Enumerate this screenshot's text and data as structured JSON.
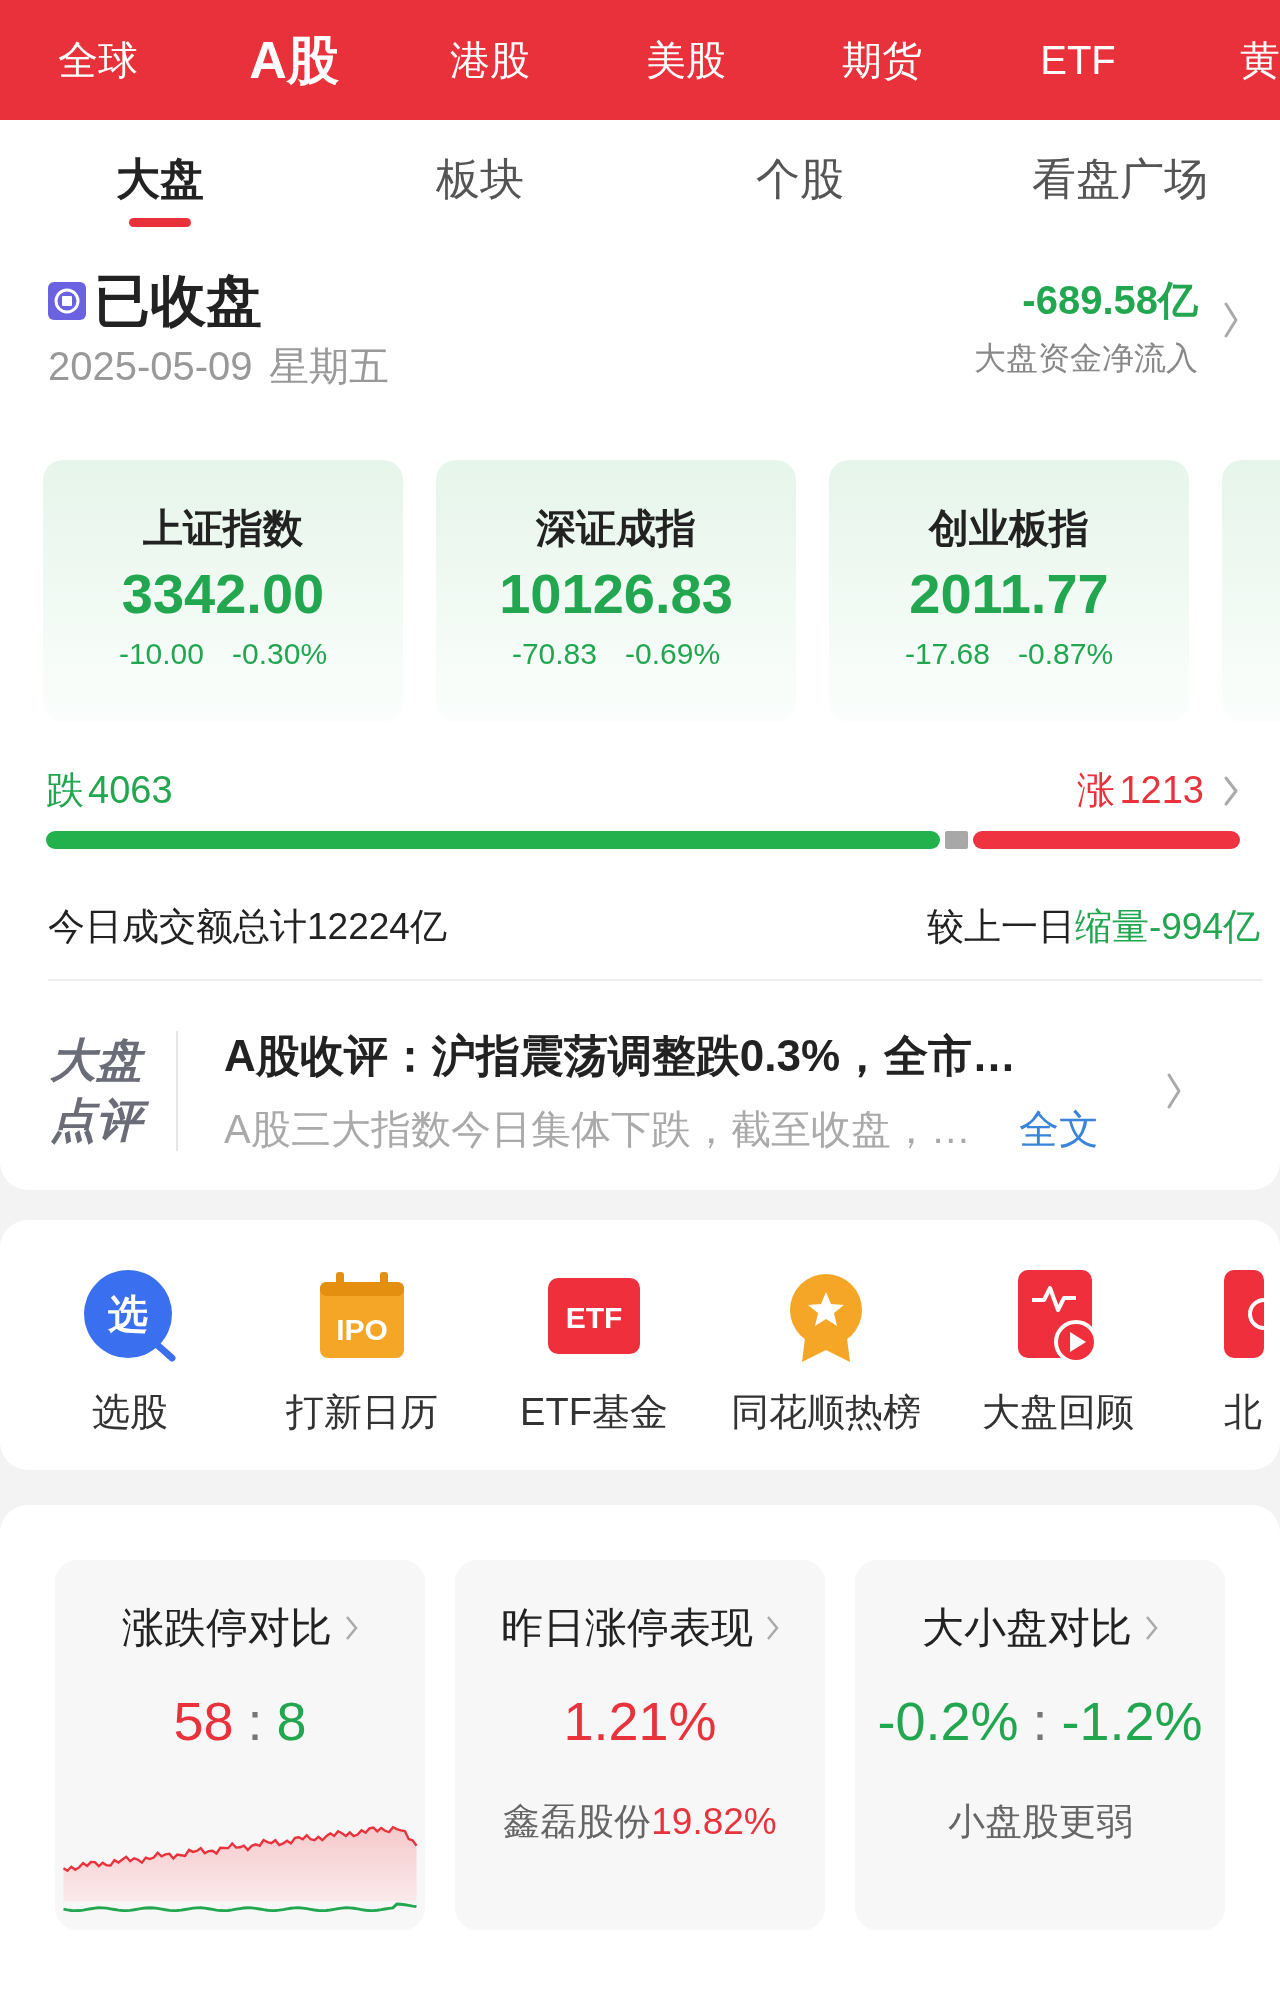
{
  "market_tabs": [
    {
      "label": "全球",
      "selected": false
    },
    {
      "label": "A股",
      "selected": true
    },
    {
      "label": "港股",
      "selected": false
    },
    {
      "label": "美股",
      "selected": false
    },
    {
      "label": "期货",
      "selected": false
    },
    {
      "label": "ETF",
      "selected": false
    },
    {
      "label": "黄",
      "selected": false
    }
  ],
  "sub_tabs": [
    {
      "label": "大盘",
      "selected": true
    },
    {
      "label": "板块",
      "selected": false
    },
    {
      "label": "个股",
      "selected": false
    },
    {
      "label": "看盘广场",
      "selected": false
    }
  ],
  "status": {
    "label": "已收盘",
    "date": "2025-05-09",
    "weekday": "星期五",
    "net_flow": "-689.58亿",
    "net_flow_label": "大盘资金净流入"
  },
  "indices": [
    {
      "name": "上证指数",
      "value": "3342.00",
      "change": "-10.00",
      "change_pct": "-0.30%"
    },
    {
      "name": "深证成指",
      "value": "10126.83",
      "change": "-70.83",
      "change_pct": "-0.69%"
    },
    {
      "name": "创业板指",
      "value": "2011.77",
      "change": "-17.68",
      "change_pct": "-0.87%"
    }
  ],
  "breadth": {
    "down_label": "跌",
    "down_count": "4063",
    "up_label": "涨",
    "up_count": "1213"
  },
  "turnover": {
    "total": "今日成交额总计12224亿",
    "compare_label": "较上一日",
    "compare_value": "缩量-994亿"
  },
  "commentary": {
    "logo_lines": [
      "大盘",
      "点评"
    ],
    "title": "A股收评：沪指震荡调整跌0.3%，全市…",
    "summary": "A股三大指数今日集体下跌，截至收盘，…",
    "link": "全文"
  },
  "shortcuts": [
    {
      "label": "选股",
      "kind": "search",
      "icon_text": "选"
    },
    {
      "label": "打新日历",
      "kind": "calendar",
      "icon_text": "IPO"
    },
    {
      "label": "ETF基金",
      "kind": "tag",
      "icon_text": "ETF"
    },
    {
      "label": "同花顺热榜",
      "kind": "medal"
    },
    {
      "label": "大盘回顾",
      "kind": "replay"
    },
    {
      "label": "北",
      "kind": "partial"
    }
  ],
  "summaries": [
    {
      "title": "涨跌停对比",
      "kind": "chart",
      "value": [
        {
          "text": "58",
          "color": "#e8323c"
        },
        {
          "text": ":",
          "color": "#777777"
        },
        {
          "text": "8",
          "color": "#22a650"
        }
      ]
    },
    {
      "title": "昨日涨停表现",
      "kind": "note",
      "value": [
        {
          "text": "1.21%",
          "color": "#e8323c"
        }
      ],
      "note": [
        {
          "text": "鑫磊股份",
          "color": "#666666"
        },
        {
          "text": "19.82%",
          "color": "#e8323c"
        }
      ]
    },
    {
      "title": "大小盘对比",
      "kind": "note",
      "value": [
        {
          "text": "-0.2%",
          "color": "#22a650"
        },
        {
          "text": ":",
          "color": "#777777"
        },
        {
          "text": "-1.2%",
          "color": "#22a650"
        }
      ],
      "note": [
        {
          "text": "小盘股更弱",
          "color": "#666666"
        }
      ]
    }
  ]
}
